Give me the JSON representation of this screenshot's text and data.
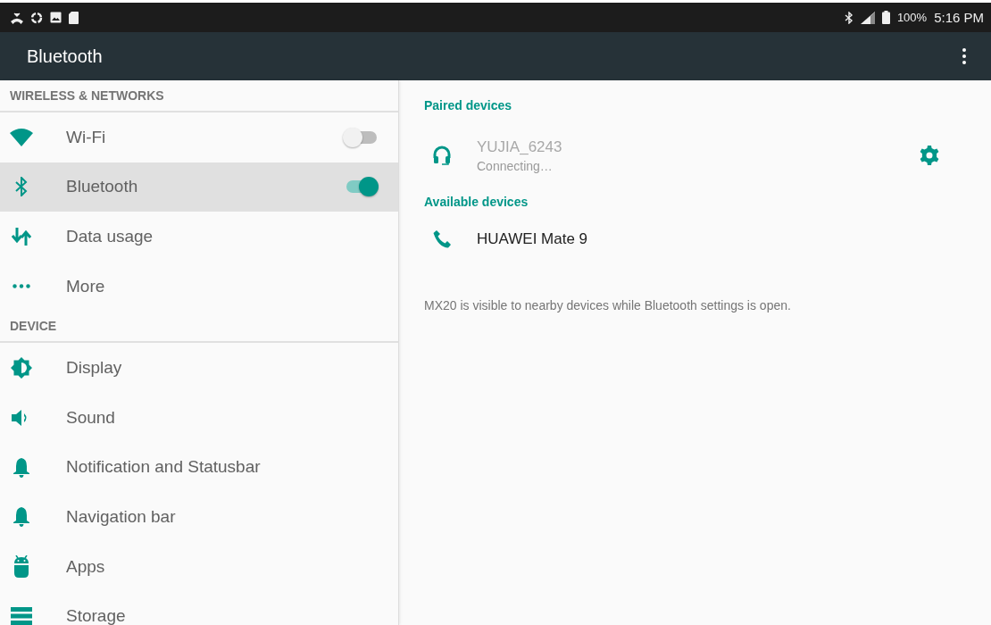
{
  "status_bar": {
    "battery": "100%",
    "time": "5:16 PM"
  },
  "app_bar": {
    "title": "Bluetooth"
  },
  "sidebar": {
    "sections": [
      {
        "title": "WIRELESS & NETWORKS",
        "items": [
          {
            "label": "Wi-Fi",
            "kind": "toggle",
            "on": false,
            "selected": false
          },
          {
            "label": "Bluetooth",
            "kind": "toggle",
            "on": true,
            "selected": true
          },
          {
            "label": "Data usage",
            "kind": "link",
            "selected": false
          },
          {
            "label": "More",
            "kind": "link",
            "selected": false
          }
        ]
      },
      {
        "title": "DEVICE",
        "items": [
          {
            "label": "Display",
            "kind": "link",
            "selected": false
          },
          {
            "label": "Sound",
            "kind": "link",
            "selected": false
          },
          {
            "label": "Notification and Statusbar",
            "kind": "link",
            "selected": false
          },
          {
            "label": "Navigation bar",
            "kind": "link",
            "selected": false
          },
          {
            "label": "Apps",
            "kind": "link",
            "selected": false
          },
          {
            "label": "Storage",
            "kind": "link",
            "selected": false
          }
        ]
      }
    ]
  },
  "content": {
    "groups": [
      {
        "title": "Paired devices",
        "devices": [
          {
            "name": "YUJIA_6243",
            "status": "Connecting…",
            "disabled": true,
            "kind": "headset"
          }
        ]
      },
      {
        "title": "Available devices",
        "devices": [
          {
            "name": "HUAWEI Mate 9",
            "disabled": false,
            "kind": "phone"
          }
        ]
      }
    ],
    "footer": "MX20 is visible to nearby devices while Bluetooth settings is open."
  }
}
